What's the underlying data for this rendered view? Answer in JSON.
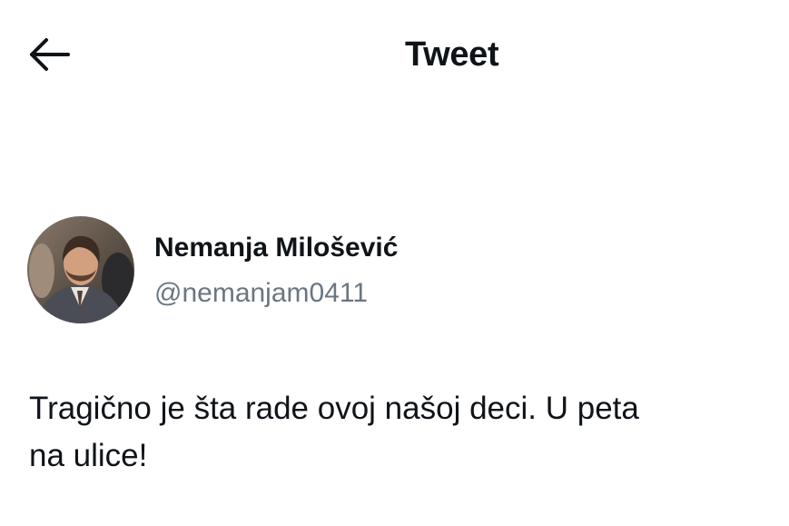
{
  "header": {
    "title": "Tweet",
    "back_icon": "arrow-left-icon"
  },
  "author": {
    "name": "Nemanja Milošević",
    "handle": "@nemanjam0411",
    "avatar": "avatar-photo"
  },
  "tweet": {
    "line1": "Tragično je šta rade ovoj našoj deci. U peta",
    "line2": "na ulice!"
  },
  "colors": {
    "text": "#0f1419",
    "secondary_text": "#6b7680",
    "background": "#ffffff"
  }
}
